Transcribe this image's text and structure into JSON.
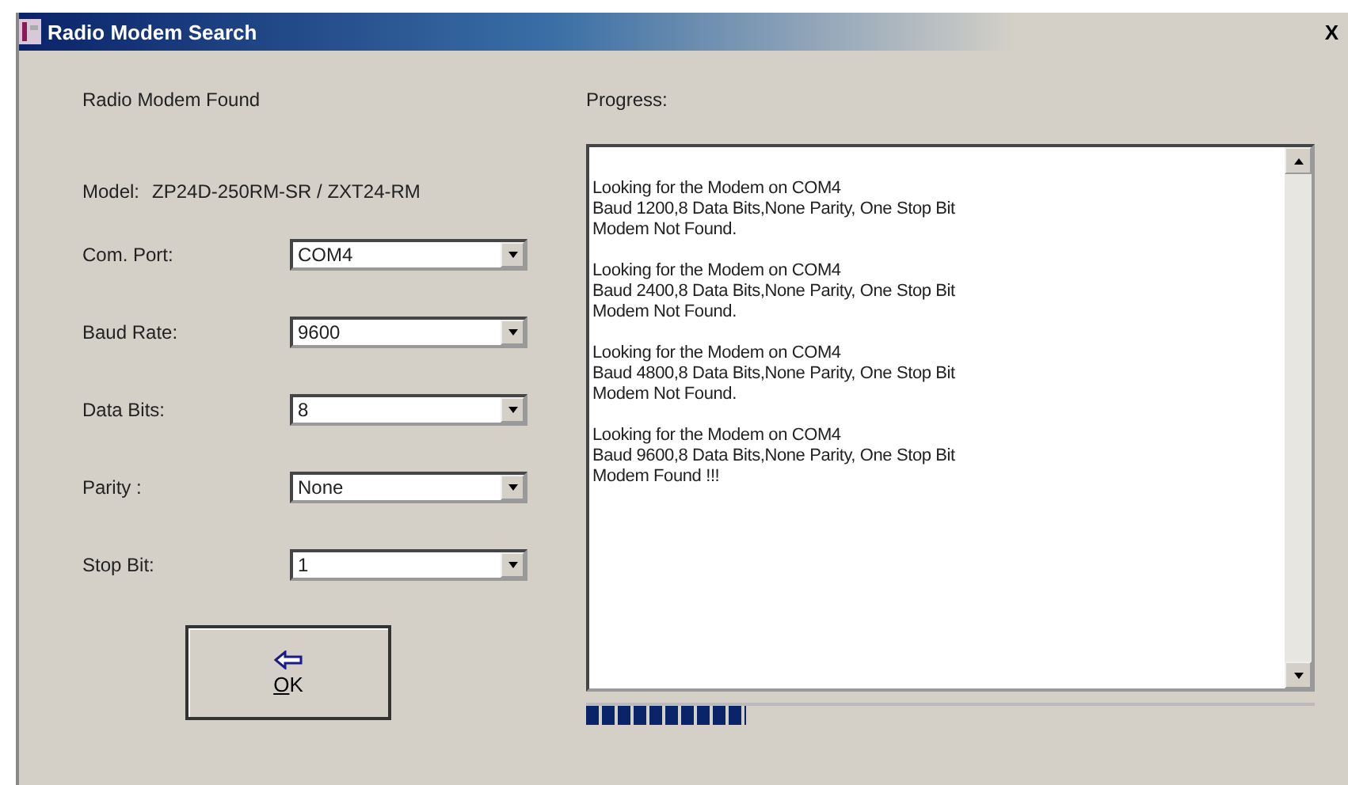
{
  "window": {
    "title": "Radio Modem Search",
    "close": "X"
  },
  "found_label": "Radio Modem Found",
  "model": {
    "label": "Model:",
    "value": "ZP24D-250RM-SR / ZXT24-RM"
  },
  "fields": [
    {
      "label": "Com. Port:",
      "value": "COM4"
    },
    {
      "label": "Baud Rate:",
      "value": "9600"
    },
    {
      "label": "Data Bits:",
      "value": "8"
    },
    {
      "label": "Parity :",
      "value": "None"
    },
    {
      "label": "Stop Bit:",
      "value": "1"
    }
  ],
  "ok_button": {
    "label": "OK"
  },
  "progress": {
    "label": "Progress:",
    "level": 0.22,
    "log": [
      {
        "lines": [
          "Looking for the Modem on COM4",
          "Baud 1200,8 Data Bits,None Parity, One Stop Bit",
          "Modem Not Found."
        ]
      },
      {
        "lines": [
          "Looking for the Modem on COM4",
          "Baud 2400,8 Data Bits,None Parity, One Stop Bit",
          "Modem Not Found."
        ]
      },
      {
        "lines": [
          "Looking for the Modem on COM4",
          "Baud 4800,8 Data Bits,None Parity, One Stop Bit",
          "Modem Not Found."
        ]
      },
      {
        "lines": [
          "Looking for the Modem on COM4",
          "Baud 9600,8 Data Bits,None Parity, One Stop Bit",
          "Modem Found !!!"
        ]
      }
    ]
  }
}
